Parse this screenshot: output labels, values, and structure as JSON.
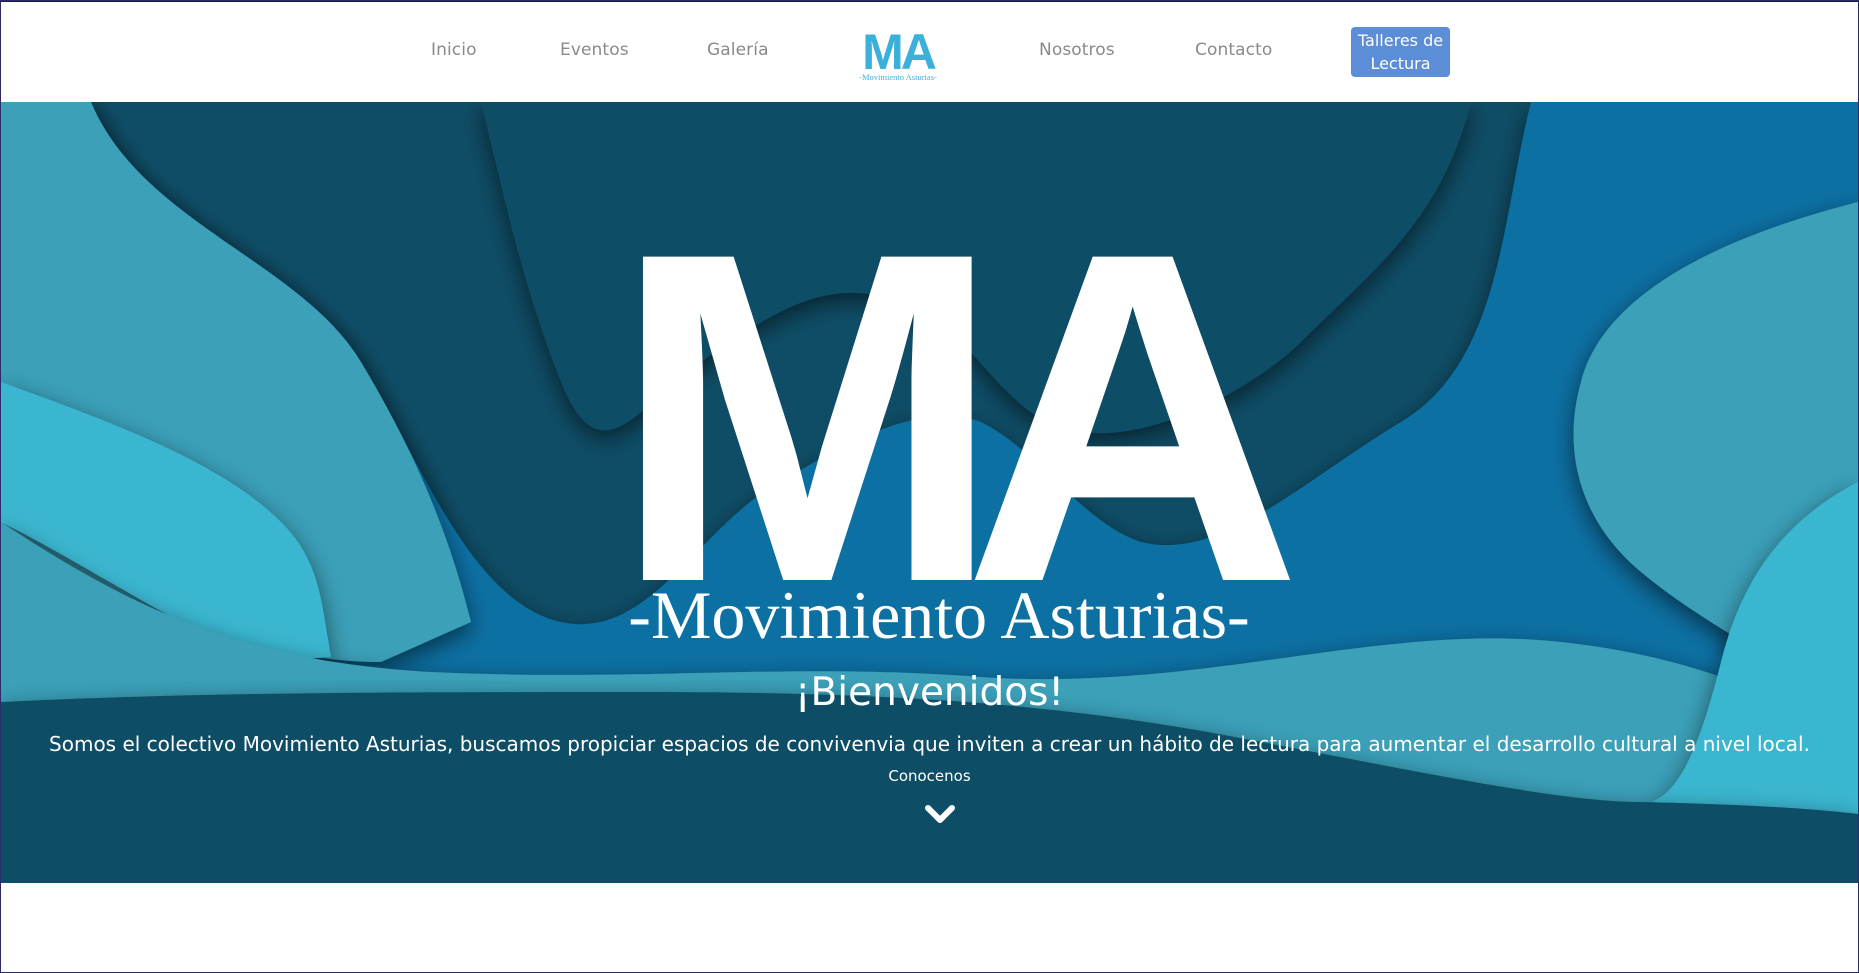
{
  "nav": {
    "items": [
      {
        "label": "Inicio"
      },
      {
        "label": "Eventos"
      },
      {
        "label": "Galería"
      },
      {
        "label": "Nosotros"
      },
      {
        "label": "Contacto"
      }
    ],
    "logo": {
      "mark": "MA",
      "subtitle": "-Movimiento Asturias-"
    },
    "cta": {
      "line1": "Talleres de",
      "line2": "Lectura"
    }
  },
  "hero": {
    "logo": {
      "mark": "MA",
      "subtitle": "-Movimiento Asturias-"
    },
    "welcome": "¡Bienvenidos!",
    "tagline": "Somos el colectivo Movimiento Asturias, buscamos propiciar espacios de convivenvia que inviten a crear un hábito de lectura para aumentar el desarrollo cultural a nivel local.",
    "scroll_label": "Conocenos",
    "scroll_icon": "chevron-down-icon"
  },
  "colors": {
    "accent": "#3ab0db",
    "cta": "#5b8ed6",
    "hero_dark": "#0f4d66",
    "hero_mid": "#0a6fa3",
    "hero_light": "#3aa0b8",
    "hero_cyan": "#3bb6d0"
  }
}
